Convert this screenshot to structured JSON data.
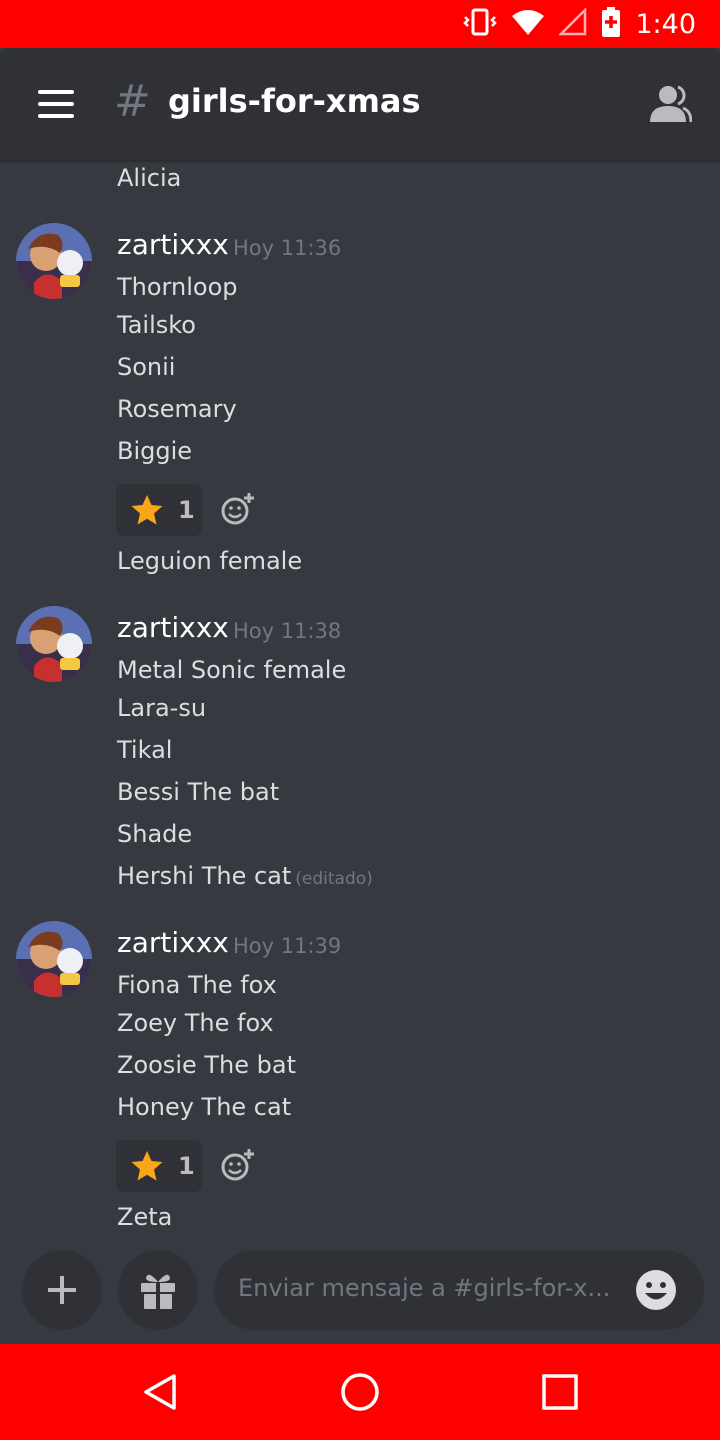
{
  "status_bar": {
    "time": "1:40"
  },
  "header": {
    "hash": "#",
    "channel_name": "girls-for-xmas"
  },
  "messages": {
    "continued_line": "Alicia",
    "groups": [
      {
        "author": "zartixxx",
        "timestamp": "Hoy 11:36",
        "lines": [
          "Thornloop",
          "Tailsko",
          "Sonii",
          "Rosemary",
          "Biggie"
        ],
        "reaction": {
          "emoji": "star",
          "count": "1"
        },
        "after_reaction_line": "Leguion female"
      },
      {
        "author": "zartixxx",
        "timestamp": "Hoy 11:38",
        "lines": [
          "Metal Sonic female",
          "Lara-su",
          "Tikal",
          "Bessi The bat",
          "Shade",
          "Hershi The cat"
        ],
        "edited_label": "(editado)"
      },
      {
        "author": "zartixxx",
        "timestamp": "Hoy 11:39",
        "lines": [
          "Fiona The fox",
          "Zoey The fox",
          "Zoosie The bat",
          "Honey The cat"
        ],
        "reaction": {
          "emoji": "star",
          "count": "1"
        },
        "after_reaction_line": "Zeta"
      }
    ]
  },
  "composer": {
    "placeholder": "Enviar mensaje a #girls-for-x..."
  },
  "colors": {
    "status_bar": "#ff0000",
    "header": "#2f3136",
    "background": "#36393f",
    "muted": "#72767d",
    "star": "#faa61a"
  }
}
